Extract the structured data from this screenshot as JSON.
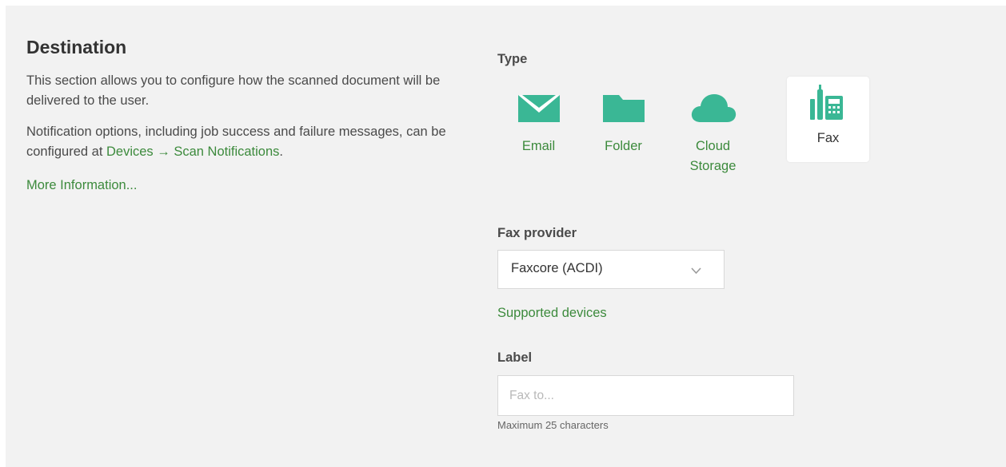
{
  "destination": {
    "title": "Destination",
    "desc1": "This section allows you to configure how the scanned document will be delivered to the user.",
    "desc2_prefix": "Notification options, including job success and failure messages, can be configured at ",
    "desc2_link": "Devices → Scan Notifications",
    "desc2_suffix": ".",
    "more_info": "More Information..."
  },
  "type": {
    "label": "Type",
    "options": [
      {
        "label": "Email",
        "icon": "envelope-icon",
        "selected": false
      },
      {
        "label": "Folder",
        "icon": "folder-icon",
        "selected": false
      },
      {
        "label": "Cloud Storage",
        "icon": "cloud-icon",
        "selected": false
      },
      {
        "label": "Fax",
        "icon": "fax-icon",
        "selected": true
      }
    ]
  },
  "fax_provider": {
    "label": "Fax provider",
    "value": "Faxcore (ACDI)"
  },
  "supported_devices": "Supported devices",
  "label_field": {
    "label": "Label",
    "placeholder": "Fax to...",
    "value": "",
    "hint": "Maximum 25 characters"
  },
  "colors": {
    "accent": "#3ab795",
    "link": "#3c8a3c",
    "panel_bg": "#f2f2f2"
  }
}
